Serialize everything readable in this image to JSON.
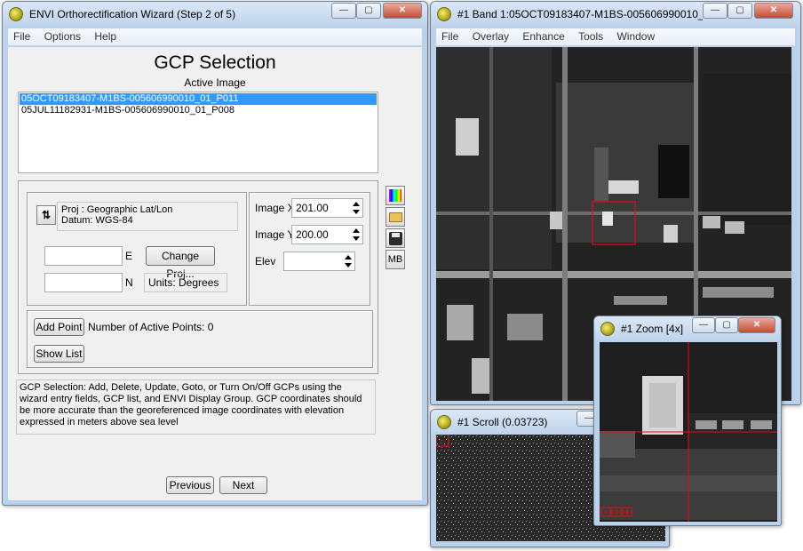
{
  "wizard": {
    "title": "ENVI Orthorectification Wizard (Step 2 of 5)",
    "menu": [
      "File",
      "Options",
      "Help"
    ],
    "heading": "GCP Selection",
    "active_image_label": "Active Image",
    "images": [
      "05OCT09183407-M1BS-005606990010_01_P011",
      "05JUL11182931-M1BS-005606990010_01_P008"
    ],
    "proj_line1": "Proj : Geographic Lat/Lon",
    "proj_line2": "Datum: WGS-84",
    "e_label": "E",
    "n_label": "N",
    "change_proj": "Change Proj...",
    "units": "Units: Degrees",
    "image_x_label": "Image X",
    "image_x_value": "201.00",
    "image_y_label": "Image Y",
    "image_y_value": "200.00",
    "elev_label": "Elev",
    "mb_label": "MB",
    "add_point": "Add Point",
    "active_points": "Number of Active Points: 0",
    "show_list": "Show List",
    "help_text": "GCP Selection: Add, Delete, Update, Goto, or Turn On/Off GCPs using the wizard entry fields, GCP list, and ENVI Display Group. GCP coordinates should be more accurate than the georeferenced image coordinates with elevation expressed in meters above sea level",
    "previous": "Previous",
    "next": "Next"
  },
  "band_window": {
    "title": "#1 Band 1:05OCT09183407-M1BS-005606990010_...",
    "menu": [
      "File",
      "Overlay",
      "Enhance",
      "Tools",
      "Window"
    ]
  },
  "scroll_window": {
    "title": "#1 Scroll (0.03723)"
  },
  "zoom_window": {
    "title": "#1 Zoom [4x]"
  },
  "window_buttons": {
    "minimize": "—",
    "maximize": "▢",
    "close": "✕"
  },
  "colors": {
    "selection": "#3399ff",
    "crosshair": "#e01010"
  }
}
